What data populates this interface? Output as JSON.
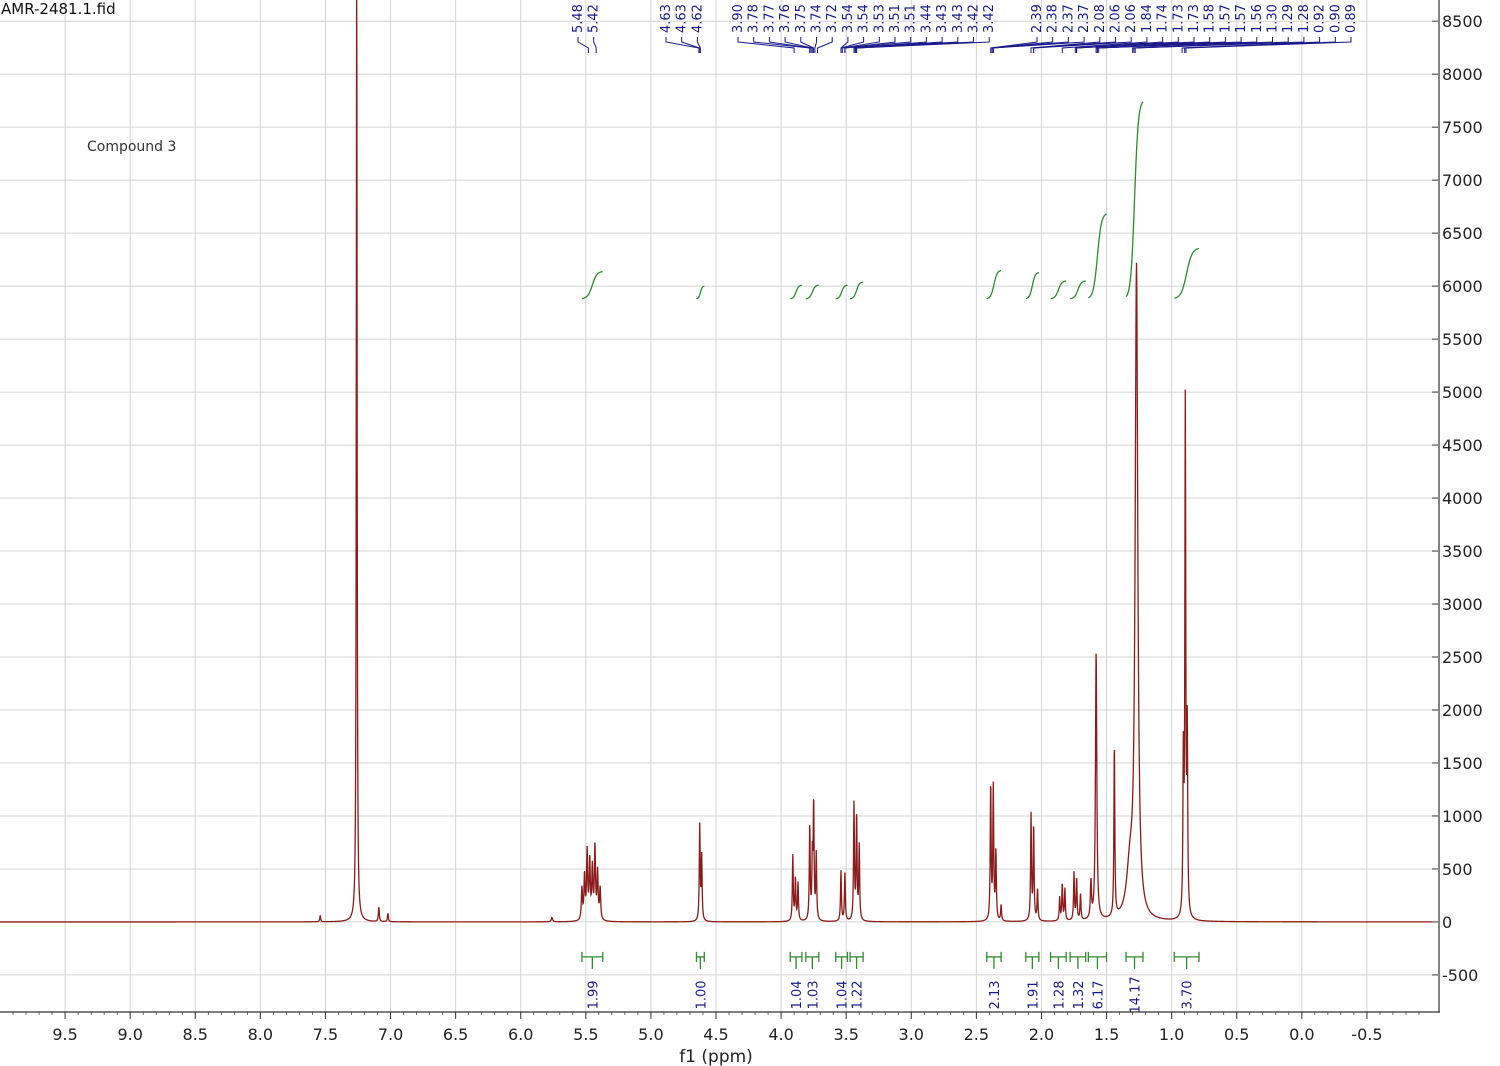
{
  "file_title": "AMR-2481.1.fid",
  "compound_label": "Compound 3",
  "colors": {
    "spectrum": "#8b1a1a",
    "integral": "#2e8b2e",
    "peak_label": "#1a1a8b",
    "grid": "#d4d4d4",
    "axis": "#333333"
  },
  "chart_data": {
    "type": "line",
    "title": "",
    "xlabel": "f1 (ppm)",
    "ylabel": "",
    "x_reversed": true,
    "xlim": [
      10.0,
      -1.0
    ],
    "ylim": [
      -850,
      8700
    ],
    "grid": true,
    "x_ticks": [
      "9.5",
      "9.0",
      "8.5",
      "8.0",
      "7.5",
      "7.0",
      "6.5",
      "6.0",
      "5.5",
      "5.0",
      "4.5",
      "4.0",
      "3.5",
      "3.0",
      "2.5",
      "2.0",
      "1.5",
      "1.0",
      "0.5",
      "0.0",
      "-0.5"
    ],
    "y_ticks": [
      "-500",
      "0",
      "500",
      "1000",
      "1500",
      "2000",
      "2500",
      "3000",
      "3500",
      "4000",
      "4500",
      "5000",
      "5500",
      "6000",
      "6500",
      "7000",
      "7500",
      "8000",
      "8500"
    ],
    "peaks": [
      {
        "ppm": 7.54,
        "height": 60,
        "width": 0.004
      },
      {
        "ppm": 7.26,
        "height": 9500,
        "width": 0.0035
      },
      {
        "ppm": 7.09,
        "height": 140,
        "width": 0.004
      },
      {
        "ppm": 7.02,
        "height": 80,
        "width": 0.004
      },
      {
        "ppm": 5.76,
        "height": 40,
        "width": 0.006
      },
      {
        "ppm": 5.53,
        "height": 300,
        "width": 0.005
      },
      {
        "ppm": 5.51,
        "height": 420,
        "width": 0.005
      },
      {
        "ppm": 5.49,
        "height": 640,
        "width": 0.005
      },
      {
        "ppm": 5.47,
        "height": 560,
        "width": 0.005
      },
      {
        "ppm": 5.45,
        "height": 480,
        "width": 0.005
      },
      {
        "ppm": 5.43,
        "height": 690,
        "width": 0.005
      },
      {
        "ppm": 5.41,
        "height": 450,
        "width": 0.005
      },
      {
        "ppm": 5.39,
        "height": 300,
        "width": 0.005
      },
      {
        "ppm": 4.625,
        "height": 900,
        "width": 0.004
      },
      {
        "ppm": 4.61,
        "height": 600,
        "width": 0.004
      },
      {
        "ppm": 3.91,
        "height": 620,
        "width": 0.004
      },
      {
        "ppm": 3.89,
        "height": 400,
        "width": 0.004
      },
      {
        "ppm": 3.87,
        "height": 360,
        "width": 0.004
      },
      {
        "ppm": 3.78,
        "height": 900,
        "width": 0.004
      },
      {
        "ppm": 3.76,
        "height": 560,
        "width": 0.004
      },
      {
        "ppm": 3.75,
        "height": 1100,
        "width": 0.004
      },
      {
        "ppm": 3.73,
        "height": 620,
        "width": 0.004
      },
      {
        "ppm": 3.54,
        "height": 480,
        "width": 0.004
      },
      {
        "ppm": 3.51,
        "height": 450,
        "width": 0.004
      },
      {
        "ppm": 3.44,
        "height": 1100,
        "width": 0.004
      },
      {
        "ppm": 3.42,
        "height": 1000,
        "width": 0.004
      },
      {
        "ppm": 3.4,
        "height": 700,
        "width": 0.004
      },
      {
        "ppm": 2.39,
        "height": 1300,
        "width": 0.004
      },
      {
        "ppm": 2.37,
        "height": 1250,
        "width": 0.004
      },
      {
        "ppm": 2.35,
        "height": 650,
        "width": 0.004
      },
      {
        "ppm": 2.31,
        "height": 150,
        "width": 0.004
      },
      {
        "ppm": 2.08,
        "height": 1000,
        "width": 0.004
      },
      {
        "ppm": 2.06,
        "height": 900,
        "width": 0.004
      },
      {
        "ppm": 2.03,
        "height": 300,
        "width": 0.004
      },
      {
        "ppm": 1.86,
        "height": 220,
        "width": 0.004
      },
      {
        "ppm": 1.84,
        "height": 350,
        "width": 0.004
      },
      {
        "ppm": 1.82,
        "height": 300,
        "width": 0.004
      },
      {
        "ppm": 1.75,
        "height": 450,
        "width": 0.004
      },
      {
        "ppm": 1.73,
        "height": 400,
        "width": 0.004
      },
      {
        "ppm": 1.7,
        "height": 250,
        "width": 0.004
      },
      {
        "ppm": 1.58,
        "height": 2550,
        "width": 0.006
      },
      {
        "ppm": 1.62,
        "height": 350,
        "width": 0.005
      },
      {
        "ppm": 1.44,
        "height": 1650,
        "width": 0.004
      },
      {
        "ppm": 1.32,
        "height": 450,
        "width": 0.03
      },
      {
        "ppm": 1.27,
        "height": 6100,
        "width": 0.012
      },
      {
        "ppm": 0.91,
        "height": 1450,
        "width": 0.004
      },
      {
        "ppm": 0.895,
        "height": 4850,
        "width": 0.004
      },
      {
        "ppm": 0.88,
        "height": 1700,
        "width": 0.004
      }
    ],
    "integrals": [
      {
        "label": "1.99",
        "start": 5.53,
        "end": 5.37,
        "base": 5880,
        "rise": 260
      },
      {
        "label": "1.00",
        "start": 4.65,
        "end": 4.59,
        "base": 5880,
        "rise": 120
      },
      {
        "label": "1.04",
        "start": 3.93,
        "end": 3.84,
        "base": 5880,
        "rise": 130
      },
      {
        "label": "1.03",
        "start": 3.81,
        "end": 3.71,
        "base": 5880,
        "rise": 130
      },
      {
        "label": "1.04",
        "start": 3.58,
        "end": 3.49,
        "base": 5880,
        "rise": 130
      },
      {
        "label": "1.22",
        "start": 3.47,
        "end": 3.37,
        "base": 5880,
        "rise": 160
      },
      {
        "label": "2.13",
        "start": 2.42,
        "end": 2.31,
        "base": 5880,
        "rise": 270
      },
      {
        "label": "1.91",
        "start": 2.12,
        "end": 2.02,
        "base": 5880,
        "rise": 250
      },
      {
        "label": "1.28",
        "start": 1.93,
        "end": 1.81,
        "base": 5880,
        "rise": 170
      },
      {
        "label": "1.32",
        "start": 1.78,
        "end": 1.66,
        "base": 5880,
        "rise": 170
      },
      {
        "label": "6.17",
        "start": 1.64,
        "end": 1.5,
        "base": 5880,
        "rise": 810
      },
      {
        "label": "14.17",
        "start": 1.35,
        "end": 1.22,
        "base": 5880,
        "rise": 1880
      },
      {
        "label": "3.70",
        "start": 0.98,
        "end": 0.79,
        "base": 5880,
        "rise": 480
      }
    ],
    "peak_label_groups": [
      {
        "labels": [
          "5.48",
          "5.42"
        ],
        "ppm": [
          5.48,
          5.42
        ]
      },
      {
        "labels": [
          "4.63",
          "4.63",
          "4.62"
        ],
        "ppm": [
          4.631,
          4.628,
          4.62
        ]
      },
      {
        "labels": [
          "3.90",
          "3.78",
          "3.77",
          "3.76",
          "3.75",
          "3.74",
          "3.72",
          "3.54",
          "3.54",
          "3.53",
          "3.51",
          "3.51",
          "3.44",
          "3.43",
          "3.43",
          "3.42",
          "3.42"
        ],
        "ppm": [
          3.9,
          3.78,
          3.77,
          3.76,
          3.75,
          3.74,
          3.72,
          3.54,
          3.54,
          3.53,
          3.51,
          3.51,
          3.44,
          3.43,
          3.43,
          3.42,
          3.42
        ]
      },
      {
        "labels": [
          "2.39",
          "2.38",
          "2.37",
          "2.37",
          "2.08",
          "2.06",
          "2.06",
          "1.84",
          "1.74",
          "1.73",
          "1.73",
          "1.58",
          "1.57",
          "1.57",
          "1.56",
          "1.30",
          "1.29",
          "1.28",
          "0.92",
          "0.90",
          "0.89"
        ],
        "ppm": [
          2.39,
          2.38,
          2.37,
          2.37,
          2.08,
          2.06,
          2.06,
          1.84,
          1.74,
          1.73,
          1.73,
          1.58,
          1.57,
          1.57,
          1.56,
          1.3,
          1.29,
          1.28,
          0.92,
          0.9,
          0.89
        ]
      }
    ]
  }
}
